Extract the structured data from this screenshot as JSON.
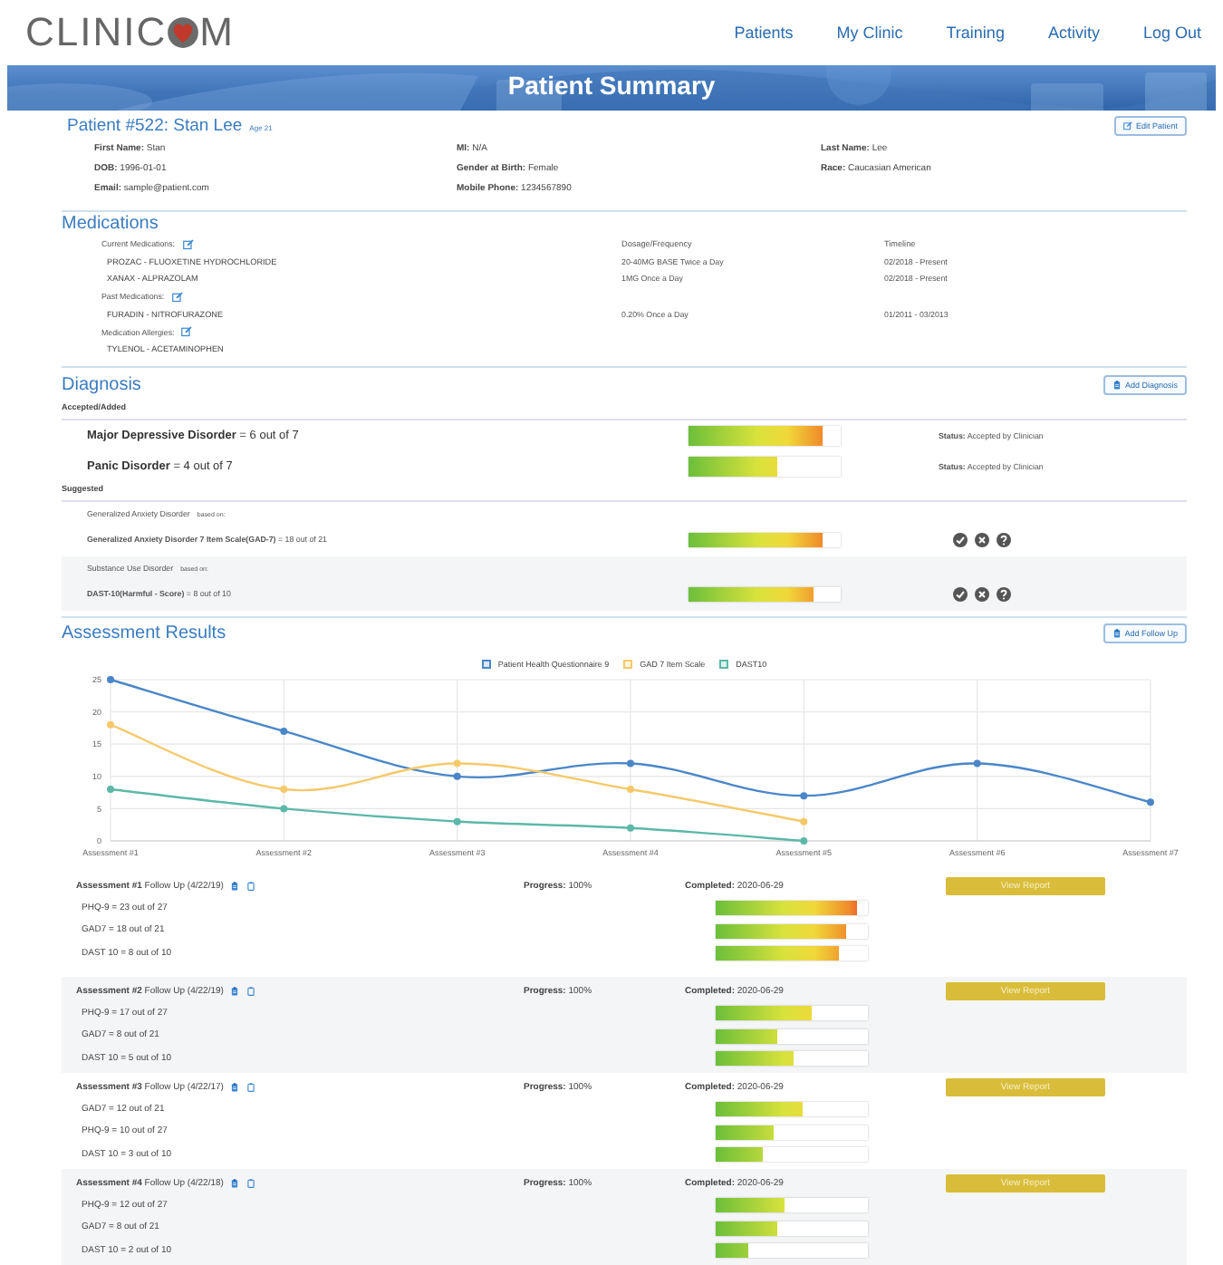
{
  "navbar": {
    "logo_before": "CLINIC",
    "logo_after": "M",
    "links": [
      "Patients",
      "My Clinic",
      "Training",
      "Activity",
      "Log Out"
    ]
  },
  "banner": {
    "title": "Patient Summary"
  },
  "patient": {
    "title": "Patient #522: Stan Lee",
    "age": "Age 21",
    "edit_button": "Edit Patient",
    "fields": [
      {
        "text": "**First Name:** Stan"
      },
      {
        "text": "**MI:** N/A"
      },
      {
        "text": "**Last Name:** Lee"
      },
      {
        "text": "**DOB:** 1996-01-01"
      },
      {
        "text": "**Gender at Birth:** Female"
      },
      {
        "text": "**Race:** Caucasian American"
      },
      {
        "text": "**Email:** sample@patient.com"
      },
      {
        "text": "**Mobile Phone:** 1234567890"
      }
    ]
  },
  "medications": {
    "title": "Medications",
    "dosage_heading": "Dosage/Frequency",
    "timeline_heading": "Timeline",
    "groups": [
      {
        "label": "Current Medications:",
        "items": [
          {
            "name": "PROZAC - FLUOXETINE HYDROCHLORIDE",
            "dosage": "20-40MG BASE Twice a Day",
            "timeline": "02/2018 - Present"
          },
          {
            "name": "XANAX - ALPRAZOLAM",
            "dosage": "1MG Once a Day",
            "timeline": "02/2018 - Present"
          }
        ]
      },
      {
        "label": "Past Medications:",
        "items": [
          {
            "name": "FURADIN - NITROFURAZONE",
            "dosage": "0.20% Once a Day",
            "timeline": "01/2011 - 03/2013"
          }
        ]
      },
      {
        "label": "Medication Allergies:",
        "items": [
          {
            "name": "TYLENOL - ACETAMINOPHEN"
          }
        ]
      }
    ]
  },
  "diagnosis": {
    "title": "Diagnosis",
    "add_button": "Add Diagnosis",
    "accepted_heading": "Accepted/Added",
    "accepted": [
      {
        "text": "**Major Depressive Disorder** = 6 out of 7",
        "level": 0.88,
        "status": "**Status:** Accepted by Clinician"
      },
      {
        "text": "**Panic Disorder** = 4 out of 7",
        "level": 0.58,
        "status": "**Status:** Accepted by Clinician"
      }
    ],
    "suggested_heading": "Suggested",
    "suggested": [
      {
        "name": "Generalized Anxiety Disorder",
        "basis": "based on:",
        "scale": "**Generalized Anxiety Disorder 7 Item Scale(GAD-7)** = 18 out of 21",
        "level": 0.88
      },
      {
        "name": "Substance Use Disorder",
        "basis": "based on:",
        "scale": "**DAST-10(Harmful - Score)** = 8 out of 10",
        "level": 0.82
      }
    ]
  },
  "assessment": {
    "title": "Assessment Results",
    "add_button": "Add Follow Up",
    "chart_data": {
      "type": "line",
      "categories": [
        "Assessment #1",
        "Assessment #2",
        "Assessment #3",
        "Assessment #4",
        "Assessment #5",
        "Assessment #6",
        "Assessment #7"
      ],
      "ylim": [
        0,
        25
      ],
      "grid": true,
      "legend": "top",
      "yticks": [
        0,
        5,
        10,
        15,
        20,
        25
      ],
      "series": [
        {
          "name": "Patient Health Questionnaire 9",
          "color": "#4a86c8",
          "marker": "circle",
          "values": [
            25,
            17,
            10,
            12,
            7,
            12,
            6
          ]
        },
        {
          "name": "GAD 7 Item Scale",
          "color": "#f5c96a",
          "marker": "circle",
          "values": [
            18,
            8,
            12,
            8,
            3,
            null,
            null
          ]
        },
        {
          "name": "DAST10",
          "color": "#5cb8a8",
          "marker": "circle",
          "values": [
            8,
            5,
            3,
            2,
            0,
            null,
            null
          ]
        }
      ]
    },
    "rows": [
      {
        "title": "**Assessment #1** Follow Up (4/22/19)",
        "progress": "**Progress:** 100%",
        "completed": "**Completed:** 2020-06-29",
        "button": "View Report",
        "scores": [
          {
            "text": "PHQ-9 = 23 out of 27",
            "level": 0.93
          },
          {
            "text": "GAD7 = 18 out of 21",
            "level": 0.86
          },
          {
            "text": "DAST 10 = 8 out of 10",
            "level": 0.81
          }
        ]
      },
      {
        "title": "**Assessment #2** Follow Up (4/22/19)",
        "progress": "**Progress:** 100%",
        "completed": "**Completed:** 2020-06-29",
        "button": "View Report",
        "scores": [
          {
            "text": "PHQ-9 = 17 out of 27",
            "level": 0.63
          },
          {
            "text": "GAD7 = 8 out of 21",
            "level": 0.4
          },
          {
            "text": "DAST 10 = 5 out of 10",
            "level": 0.51
          }
        ]
      },
      {
        "title": "**Assessment #3** Follow Up (4/22/17)",
        "progress": "**Progress:** 100%",
        "completed": "**Completed:** 2020-06-29",
        "button": "View Report",
        "scores": [
          {
            "text": "GAD7 = 12 out of 21",
            "level": 0.57
          },
          {
            "text": "PHQ-9 = 10 out of 27",
            "level": 0.38
          },
          {
            "text": "DAST 10 = 3 out of 10",
            "level": 0.31
          }
        ]
      },
      {
        "title": "**Assessment #4** Follow Up (4/22/18)",
        "progress": "**Progress:** 100%",
        "completed": "**Completed:** 2020-06-29",
        "button": "View Report",
        "scores": [
          {
            "text": "PHQ-9 = 12 out of 27",
            "level": 0.45
          },
          {
            "text": "GAD7 = 8 out of 21",
            "level": 0.4
          },
          {
            "text": "DAST 10 = 2 out of 10",
            "level": 0.21
          }
        ]
      }
    ]
  }
}
